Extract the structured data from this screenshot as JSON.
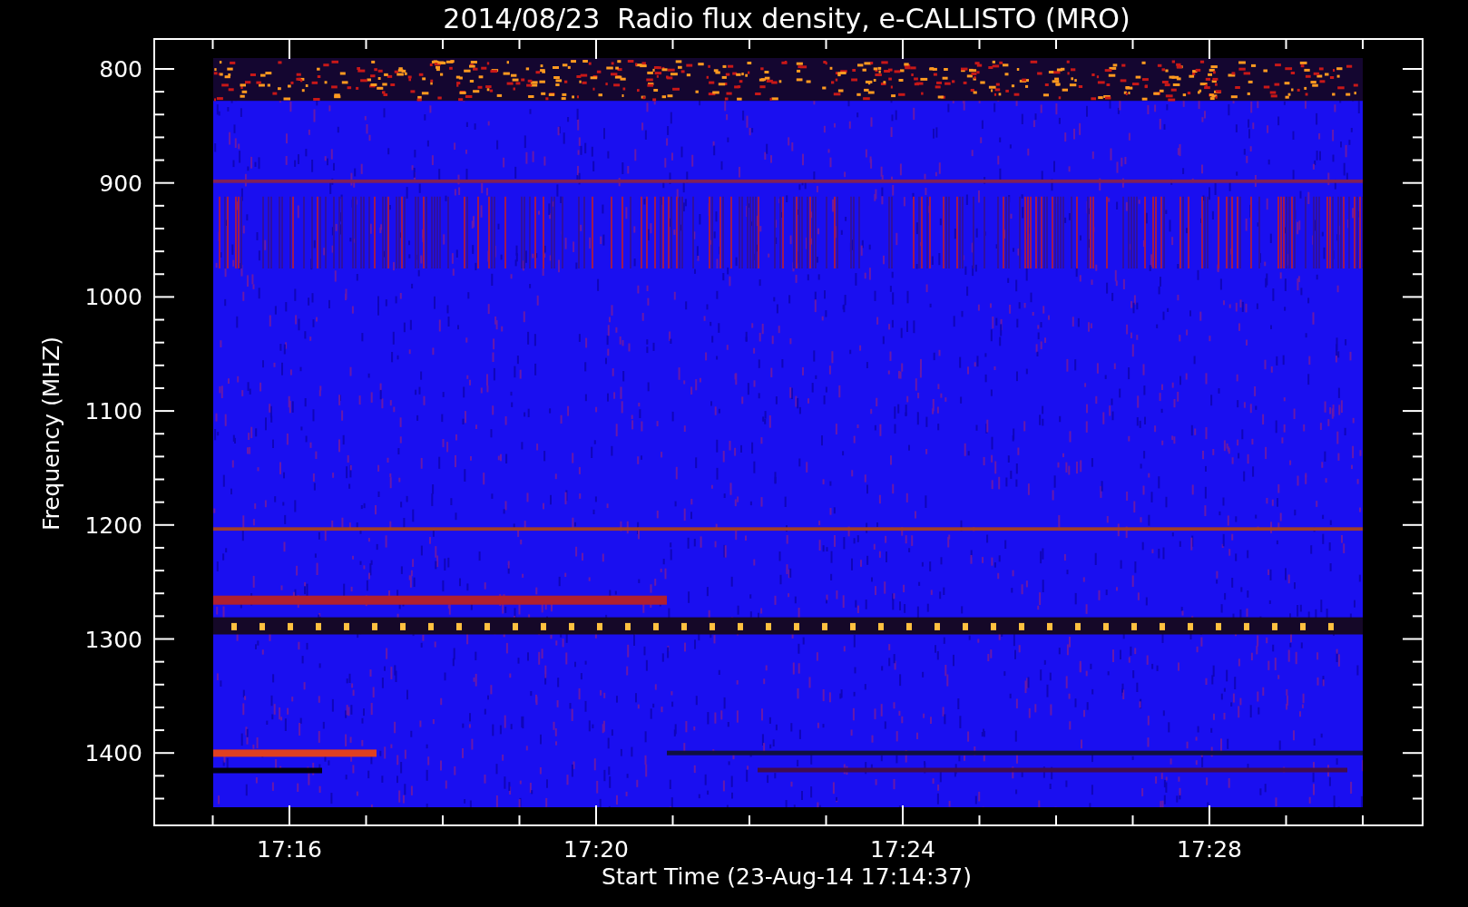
{
  "title": "2014/08/23  Radio flux density, e-CALLISTO (MRO)",
  "y_axis": {
    "label": "Frequency (MHZ)",
    "ticks": [
      "800",
      "900",
      "1000",
      "1100",
      "1200",
      "1300",
      "1400"
    ]
  },
  "x_axis": {
    "label": "Start Time (23-Aug-14 17:14:37)",
    "ticks": [
      "17:16",
      "17:20",
      "17:24",
      "17:28"
    ]
  }
}
